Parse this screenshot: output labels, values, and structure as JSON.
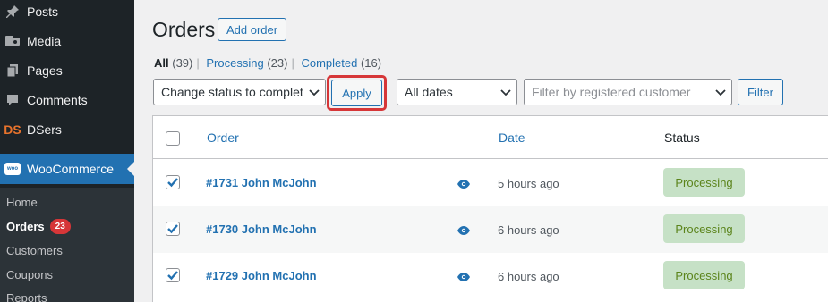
{
  "sidebar": {
    "items": [
      {
        "label": "Posts",
        "icon": "pushpin-icon"
      },
      {
        "label": "Media",
        "icon": "media-icon"
      },
      {
        "label": "Pages",
        "icon": "pages-icon"
      },
      {
        "label": "Comments",
        "icon": "comment-icon"
      },
      {
        "label": "DSers",
        "icon_text": "DS"
      },
      {
        "label": "WooCommerce",
        "icon_text": "woo"
      }
    ],
    "submenu": [
      {
        "label": "Home"
      },
      {
        "label": "Orders",
        "badge": "23"
      },
      {
        "label": "Customers"
      },
      {
        "label": "Coupons"
      },
      {
        "label": "Reports"
      }
    ]
  },
  "page": {
    "title": "Orders",
    "add_order_label": "Add order"
  },
  "views": {
    "all_label": "All",
    "all_count": "(39)",
    "processing_label": "Processing",
    "processing_count": "(23)",
    "completed_label": "Completed",
    "completed_count": "(16)",
    "separator": "|"
  },
  "filters": {
    "bulk_action_value": "Change status to complet",
    "apply_label": "Apply",
    "dates_value": "All dates",
    "customer_placeholder": "Filter by registered customer",
    "filter_label": "Filter"
  },
  "table": {
    "headers": {
      "order": "Order",
      "date": "Date",
      "status": "Status"
    },
    "rows": [
      {
        "order": "#1731 John McJohn",
        "date": "5 hours ago",
        "status": "Processing"
      },
      {
        "order": "#1730 John McJohn",
        "date": "6 hours ago",
        "status": "Processing"
      },
      {
        "order": "#1729 John McJohn",
        "date": "6 hours ago",
        "status": "Processing"
      }
    ]
  },
  "colors": {
    "sidebar_bg": "#1d2327",
    "accent": "#2271b1",
    "status_processing_bg": "#c6e1c6",
    "status_processing_text": "#5b841b",
    "highlight": "#d63638"
  }
}
